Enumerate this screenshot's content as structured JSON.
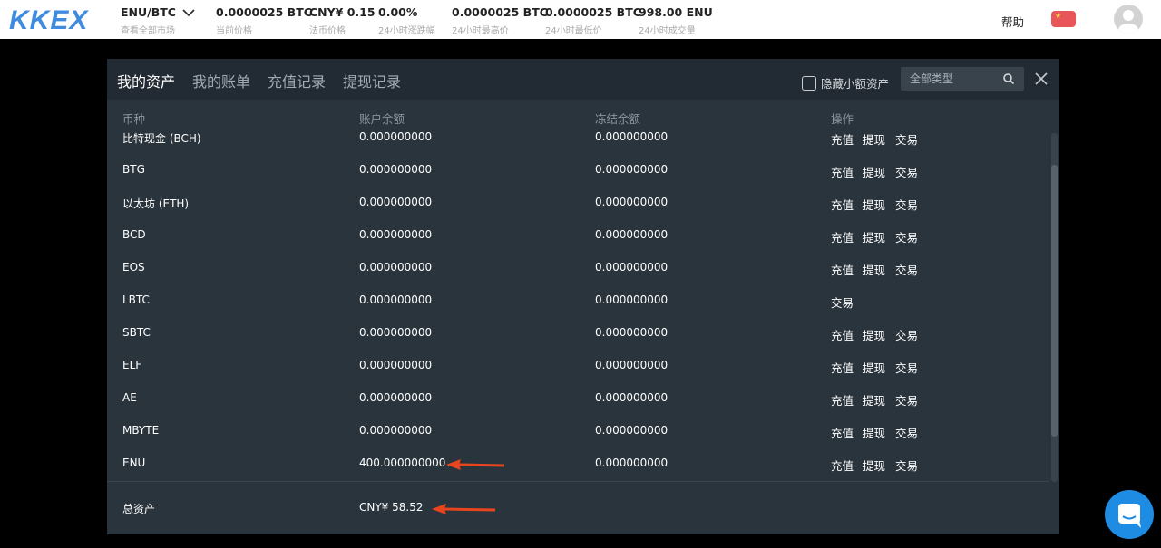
{
  "topbar": {
    "logo": "KKEX",
    "market": {
      "pair": "ENU/BTC",
      "sub": "查看全部市场"
    },
    "stats": [
      {
        "value": "0.0000025 BTC",
        "label": "当前价格"
      },
      {
        "value": "CNY¥ 0.15",
        "label": "法币价格"
      },
      {
        "value": "0.00%",
        "label": "24小时涨跌幅"
      },
      {
        "value": "0.0000025 BTC",
        "label": "24小时最高价"
      },
      {
        "value": "0.0000025 BTC",
        "label": "24小时最低价"
      },
      {
        "value": "998.00 ENU",
        "label": "24小时成交量"
      }
    ],
    "help": "帮助"
  },
  "modal": {
    "tabs": [
      "我的资产",
      "我的账单",
      "充值记录",
      "提现记录"
    ],
    "hide_small": "隐藏小额资产",
    "type_placeholder": "全部类型",
    "columns": [
      "币种",
      "账户余额",
      "冻结余额",
      "操作"
    ],
    "actions": {
      "deposit": "充值",
      "withdraw": "提现",
      "trade": "交易"
    },
    "rows": [
      {
        "coin": "比特现金 (BCH)",
        "balance": "0.000000000",
        "frozen": "0.000000000",
        "full": true
      },
      {
        "coin": "BTG",
        "balance": "0.000000000",
        "frozen": "0.000000000",
        "full": true
      },
      {
        "coin": "以太坊 (ETH)",
        "balance": "0.000000000",
        "frozen": "0.000000000",
        "full": true
      },
      {
        "coin": "BCD",
        "balance": "0.000000000",
        "frozen": "0.000000000",
        "full": true
      },
      {
        "coin": "EOS",
        "balance": "0.000000000",
        "frozen": "0.000000000",
        "full": true
      },
      {
        "coin": "LBTC",
        "balance": "0.000000000",
        "frozen": "0.000000000",
        "full": false
      },
      {
        "coin": "SBTC",
        "balance": "0.000000000",
        "frozen": "0.000000000",
        "full": true
      },
      {
        "coin": "ELF",
        "balance": "0.000000000",
        "frozen": "0.000000000",
        "full": true
      },
      {
        "coin": "AE",
        "balance": "0.000000000",
        "frozen": "0.000000000",
        "full": true
      },
      {
        "coin": "MBYTE",
        "balance": "0.000000000",
        "frozen": "0.000000000",
        "full": true
      },
      {
        "coin": "ENU",
        "balance": "400.000000000",
        "frozen": "0.000000000",
        "full": true
      }
    ],
    "total": {
      "label": "总资产",
      "value": "CNY¥ 58.52"
    }
  },
  "colors": {
    "accent": "#3f8be0",
    "modal_bg": "#2a343d",
    "annotation_arrow": "#e8451e"
  }
}
